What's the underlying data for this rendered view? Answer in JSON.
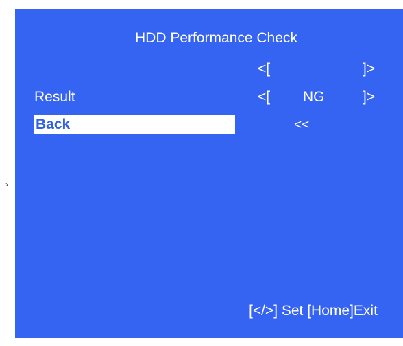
{
  "screen": {
    "title": "HDD Performance Check",
    "rows": [
      {
        "label": "",
        "bracket_open": "<[",
        "value": "",
        "bracket_close": "]>"
      },
      {
        "label": "Result",
        "bracket_open": "<[",
        "value": "NG",
        "bracket_close": "]>"
      }
    ],
    "back": {
      "label": "Back",
      "arrow": "<<"
    },
    "footer": "[</>] Set [Home]Exit"
  },
  "colors": {
    "panel": "#3563f2",
    "text": "#ffffff",
    "highlight": "#ffffff",
    "highlight_text": "#2f5fe6"
  }
}
